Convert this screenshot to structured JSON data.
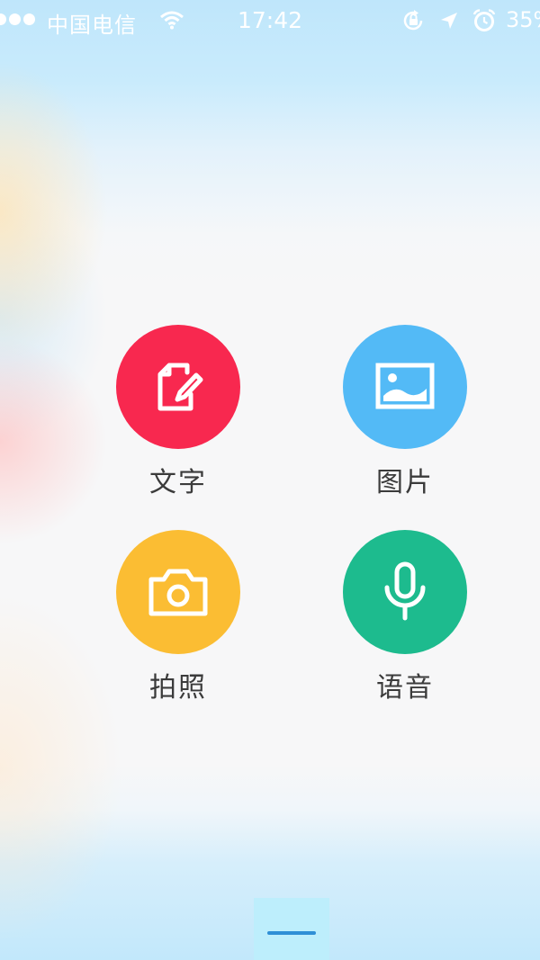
{
  "status_bar": {
    "carrier": "中国电信",
    "time": "17:42",
    "battery": "35%",
    "icons": [
      "signal-dots",
      "wifi-icon",
      "orientation-lock-icon",
      "location-icon",
      "alarm-icon"
    ]
  },
  "actions": [
    {
      "label": "文字",
      "icon": "edit-note-icon",
      "color": "#f8284f"
    },
    {
      "label": "图片",
      "icon": "image-icon",
      "color": "#53baf6"
    },
    {
      "label": "拍照",
      "icon": "camera-icon",
      "color": "#fbbd33"
    },
    {
      "label": "语音",
      "icon": "microphone-icon",
      "color": "#1dbb8e"
    }
  ],
  "close": {
    "icon": "minimize-bar-icon",
    "color": "#2f8fd6"
  }
}
